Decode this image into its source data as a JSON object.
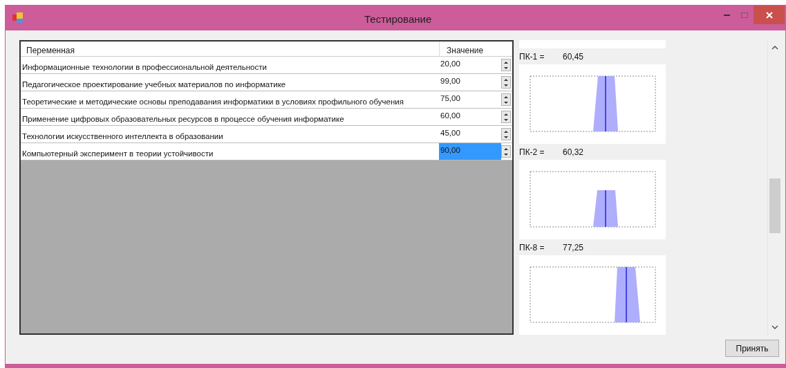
{
  "window": {
    "title": "Тестирование"
  },
  "table": {
    "columns": [
      "Переменная",
      "Значение"
    ],
    "rows": [
      {
        "name": "Информационные технологии в профессиональной деятельности",
        "value": "20,00",
        "selected": false
      },
      {
        "name": "Педагогическое проектирование учебных материалов по информатике",
        "value": "99,00",
        "selected": false
      },
      {
        "name": "Теоретические и методические основы преподавания информатики в условиях профильного обучения",
        "value": "75,00",
        "selected": false
      },
      {
        "name": "Применение цифровых образовательных ресурсов в процессе обучения информатике",
        "value": "60,00",
        "selected": false
      },
      {
        "name": "Технологии искусственного интеллекта в образовании",
        "value": "45,00",
        "selected": false
      },
      {
        "name": "Компьютерный эксперимент в теории устойчивости",
        "value": "90,00",
        "selected": true
      }
    ]
  },
  "results": [
    {
      "label": "ПК-1 =",
      "value": "60,45"
    },
    {
      "label": "ПК-2 =",
      "value": "60,32"
    },
    {
      "label": "ПК-8 =",
      "value": "77,25"
    }
  ],
  "buttons": [
    "Принять"
  ]
}
